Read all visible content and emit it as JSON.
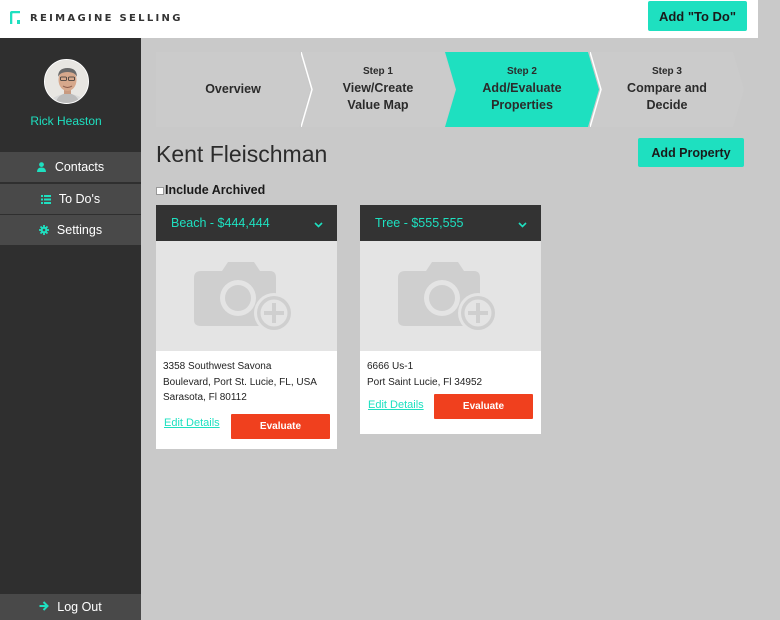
{
  "header": {
    "logo_text": "REIMAGINE SELLING",
    "add_todo_label": "Add \"To Do\""
  },
  "sidebar": {
    "user_name": "Rick Heaston",
    "items": [
      {
        "label": "Contacts",
        "icon": "person-icon"
      },
      {
        "label": "To Do's",
        "icon": "list-icon"
      },
      {
        "label": "Settings",
        "icon": "gear-icon"
      }
    ],
    "logout_label": "Log Out"
  },
  "steps": [
    {
      "small": "",
      "title_line1": "Overview",
      "title_line2": "",
      "active": false
    },
    {
      "small": "Step 1",
      "title_line1": "View/Create",
      "title_line2": "Value Map",
      "active": false
    },
    {
      "small": "Step 2",
      "title_line1": "Add/Evaluate",
      "title_line2": "Properties",
      "active": true
    },
    {
      "small": "Step 3",
      "title_line1": "Compare and",
      "title_line2": "Decide",
      "active": false
    }
  ],
  "page": {
    "title": "Kent Fleischman",
    "add_property_label": "Add Property",
    "include_archived_label": "Include Archived"
  },
  "properties": [
    {
      "title": "Beach - $444,444",
      "address_lines": [
        "3358 Southwest Savona",
        "Boulevard, Port St. Lucie, FL, USA",
        "Sarasota, Fl 80112"
      ],
      "edit_label": "Edit Details",
      "evaluate_label": "Evaluate"
    },
    {
      "title": "Tree - $555,555",
      "address_lines": [
        "6666 Us-1",
        "Port Saint Lucie, Fl 34952"
      ],
      "edit_label": "Edit Details",
      "evaluate_label": "Evaluate"
    }
  ],
  "colors": {
    "accent": "#1ee0c0",
    "sidebar_bg": "#2f2f2f",
    "nav_item_bg": "#494949",
    "card_head_bg": "#333333",
    "evaluate_button": "#f0401e",
    "step_inactive": "#cbcbcb",
    "step_active": "#1ee0c0",
    "page_bg": "#c9c9c9"
  }
}
